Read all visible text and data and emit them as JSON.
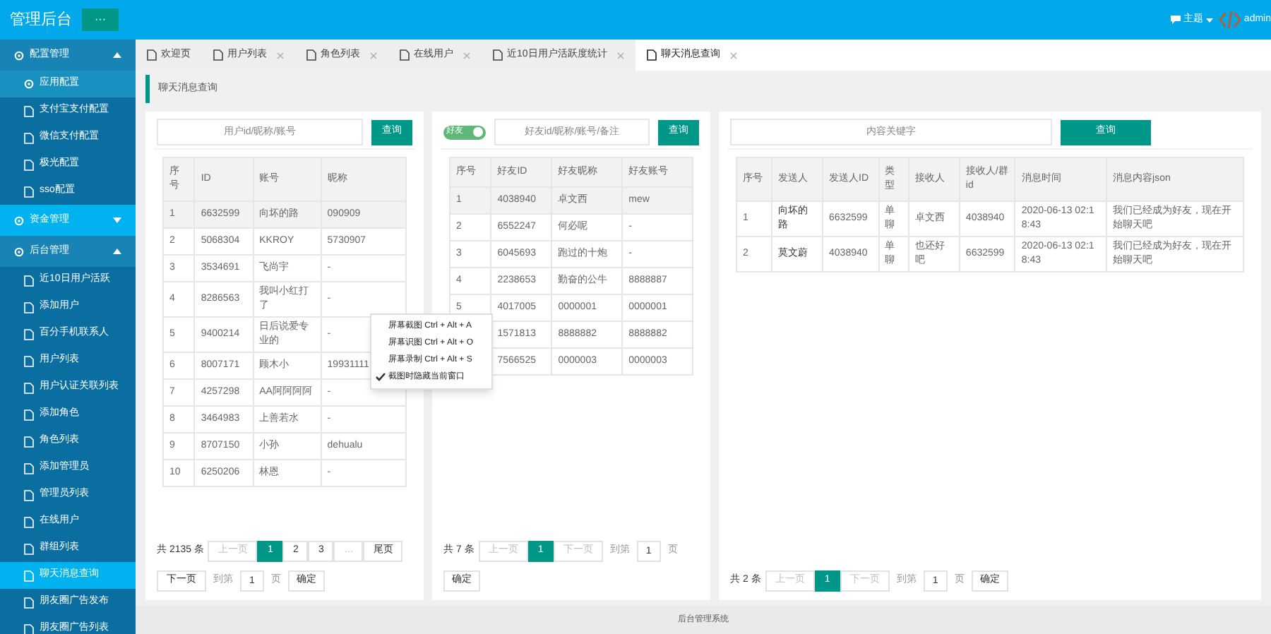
{
  "header": {
    "title": "管理后台",
    "menu_button": "···",
    "theme": "主题",
    "user": "admin"
  },
  "sidebar": {
    "groups": [
      {
        "label": "配置管理",
        "expanded": true,
        "selected": false,
        "items": [
          {
            "label": "应用配置",
            "selected": true
          },
          {
            "label": "支付宝支付配置",
            "selected": false
          },
          {
            "label": "微信支付配置",
            "selected": false
          },
          {
            "label": "极光配置",
            "selected": false
          },
          {
            "label": "sso配置",
            "selected": false
          }
        ]
      },
      {
        "label": "资金管理",
        "expanded": false,
        "selected": true
      },
      {
        "label": "后台管理",
        "expanded": true,
        "selected": false,
        "items": [
          {
            "label": "近10日用户活跃",
            "selected": false
          },
          {
            "label": "添加用户",
            "selected": false
          },
          {
            "label": "百分手机联系人",
            "selected": false
          },
          {
            "label": "用户列表",
            "selected": false
          },
          {
            "label": "用户认证关联列表",
            "selected": false
          },
          {
            "label": "添加角色",
            "selected": false
          },
          {
            "label": "角色列表",
            "selected": false
          },
          {
            "label": "添加管理员",
            "selected": false
          },
          {
            "label": "管理员列表",
            "selected": false
          },
          {
            "label": "在线用户",
            "selected": false
          },
          {
            "label": "群组列表",
            "selected": false
          },
          {
            "label": "聊天消息查询",
            "selected": true
          },
          {
            "label": "朋友圈广告发布",
            "selected": false
          },
          {
            "label": "朋友圈广告列表",
            "selected": false
          }
        ]
      }
    ]
  },
  "tabs": [
    {
      "label": "欢迎页",
      "selected": false,
      "closable": false
    },
    {
      "label": "用户列表",
      "selected": false,
      "closable": true
    },
    {
      "label": "角色列表",
      "selected": false,
      "closable": true
    },
    {
      "label": "在线用户",
      "selected": false,
      "closable": true
    },
    {
      "label": "近10日用户活跃度统计",
      "selected": false,
      "closable": true
    },
    {
      "label": "聊天消息查询",
      "selected": true,
      "closable": true
    }
  ],
  "breadcrumb": "聊天消息查询",
  "panels": [
    {
      "search": {
        "placeholder": "用户id/昵称/账号"
      },
      "search_button": "查询",
      "columns": [
        "序号",
        "ID",
        "账号",
        "昵称"
      ],
      "rows": [
        {
          "highlighted": true,
          "cells": [
            "1",
            "6632599",
            "向坏的路",
            "090909"
          ]
        },
        {
          "highlighted": false,
          "cells": [
            "2",
            "5068304",
            "KKROY",
            "5730907"
          ]
        },
        {
          "highlighted": false,
          "cells": [
            "3",
            "3534691",
            "飞尚宇",
            "-"
          ]
        },
        {
          "highlighted": false,
          "cells": [
            "4",
            "8286563",
            "我叫小红打了",
            "-"
          ]
        },
        {
          "highlighted": false,
          "cells": [
            "5",
            "9400214",
            "日后说爱专业的",
            "-"
          ]
        },
        {
          "highlighted": false,
          "cells": [
            "6",
            "8007171",
            "顾木小",
            "19931111"
          ]
        },
        {
          "highlighted": false,
          "cells": [
            "7",
            "4257298",
            "AA阿阿阿阿",
            "-"
          ]
        },
        {
          "highlighted": false,
          "cells": [
            "8",
            "3464983",
            "上善若水",
            "-"
          ]
        },
        {
          "highlighted": false,
          "cells": [
            "9",
            "8707150",
            "小孙",
            "dehualu"
          ]
        },
        {
          "highlighted": false,
          "cells": [
            "10",
            "6250206",
            "林恩",
            "-"
          ]
        }
      ],
      "pager": {
        "total": "共 2135 条",
        "pages": [
          {
            "label": "上一页",
            "selected": false,
            "disabled": true
          },
          {
            "label": "1",
            "selected": true,
            "disabled": false
          },
          {
            "label": "2",
            "selected": false,
            "disabled": false
          },
          {
            "label": "3",
            "selected": false,
            "disabled": false
          },
          {
            "label": "…",
            "selected": false,
            "disabled": true
          },
          {
            "label": "尾页",
            "selected": false,
            "disabled": false
          },
          {
            "label": "下一页",
            "selected": false,
            "disabled": false
          }
        ],
        "goto": "到第",
        "page_value": "1",
        "page_unit": "页",
        "confirm": "确定"
      }
    },
    {
      "toggle": {
        "label": "好友",
        "on": true
      },
      "search": {
        "placeholder": "好友id/昵称/账号/备注"
      },
      "search_button": "查询",
      "columns": [
        "序号",
        "好友ID",
        "好友昵称",
        "好友账号"
      ],
      "rows": [
        {
          "highlighted": true,
          "cells": [
            "1",
            "4038940",
            "卓文西",
            "mew"
          ]
        },
        {
          "highlighted": false,
          "cells": [
            "2",
            "6552247",
            "何必呢",
            "-"
          ]
        },
        {
          "highlighted": false,
          "cells": [
            "3",
            "6045693",
            "跑过的十炮",
            "-"
          ]
        },
        {
          "highlighted": false,
          "cells": [
            "4",
            "2238653",
            "勤奋的公牛",
            "8888887"
          ]
        },
        {
          "highlighted": false,
          "cells": [
            "5",
            "4017005",
            "0000001",
            "0000001"
          ]
        },
        {
          "highlighted": false,
          "cells": [
            null,
            "1571813",
            "8888882",
            "8888882"
          ]
        },
        {
          "highlighted": false,
          "cells": [
            null,
            "7566525",
            "0000003",
            "0000003"
          ]
        }
      ],
      "pager": {
        "total": "共 7 条",
        "pages": [
          {
            "label": "上一页",
            "selected": false,
            "disabled": true
          },
          {
            "label": "1",
            "selected": true,
            "disabled": false
          },
          {
            "label": "下一页",
            "selected": false,
            "disabled": true
          }
        ],
        "goto": "到第",
        "page_value": "1",
        "page_unit": "页",
        "confirm": "确定"
      }
    },
    {
      "search": {
        "placeholder": "内容关键字"
      },
      "search_button": "查询",
      "columns": [
        "序号",
        "发送人",
        "发送人ID",
        "类型",
        "接收人",
        "接收人/群id",
        "消息时间",
        "消息内容json"
      ],
      "rows": [
        {
          "highlighted": false,
          "cells": [
            "1",
            "向坏的路",
            "6632599",
            "单聊",
            "卓文西",
            "4038940",
            "2020-06-13 02:18:43",
            "我们已经成为好友，现在开始聊天吧"
          ]
        },
        {
          "highlighted": false,
          "cells": [
            "2",
            "莫文蔚",
            "4038940",
            "单聊",
            "也还好吧",
            "6632599",
            "2020-06-13 02:18:43",
            "我们已经成为好友，现在开始聊天吧"
          ]
        }
      ],
      "pager": {
        "total": "共 2 条",
        "pages": [
          {
            "label": "上一页",
            "selected": false,
            "disabled": true
          },
          {
            "label": "1",
            "selected": true,
            "disabled": false
          },
          {
            "label": "下一页",
            "selected": false,
            "disabled": true
          }
        ],
        "goto": "到第",
        "page_value": "1",
        "page_unit": "页",
        "confirm": "确定"
      }
    }
  ],
  "context_menu": [
    {
      "label": "屏幕截图 Ctrl + Alt + A",
      "checked": false
    },
    {
      "label": "屏幕识图 Ctrl + Alt + O",
      "checked": false
    },
    {
      "label": "屏幕录制 Ctrl + Alt + S",
      "checked": false
    },
    {
      "label": "截图时隐藏当前窗口",
      "checked": true
    }
  ],
  "footer": "后台管理系统"
}
